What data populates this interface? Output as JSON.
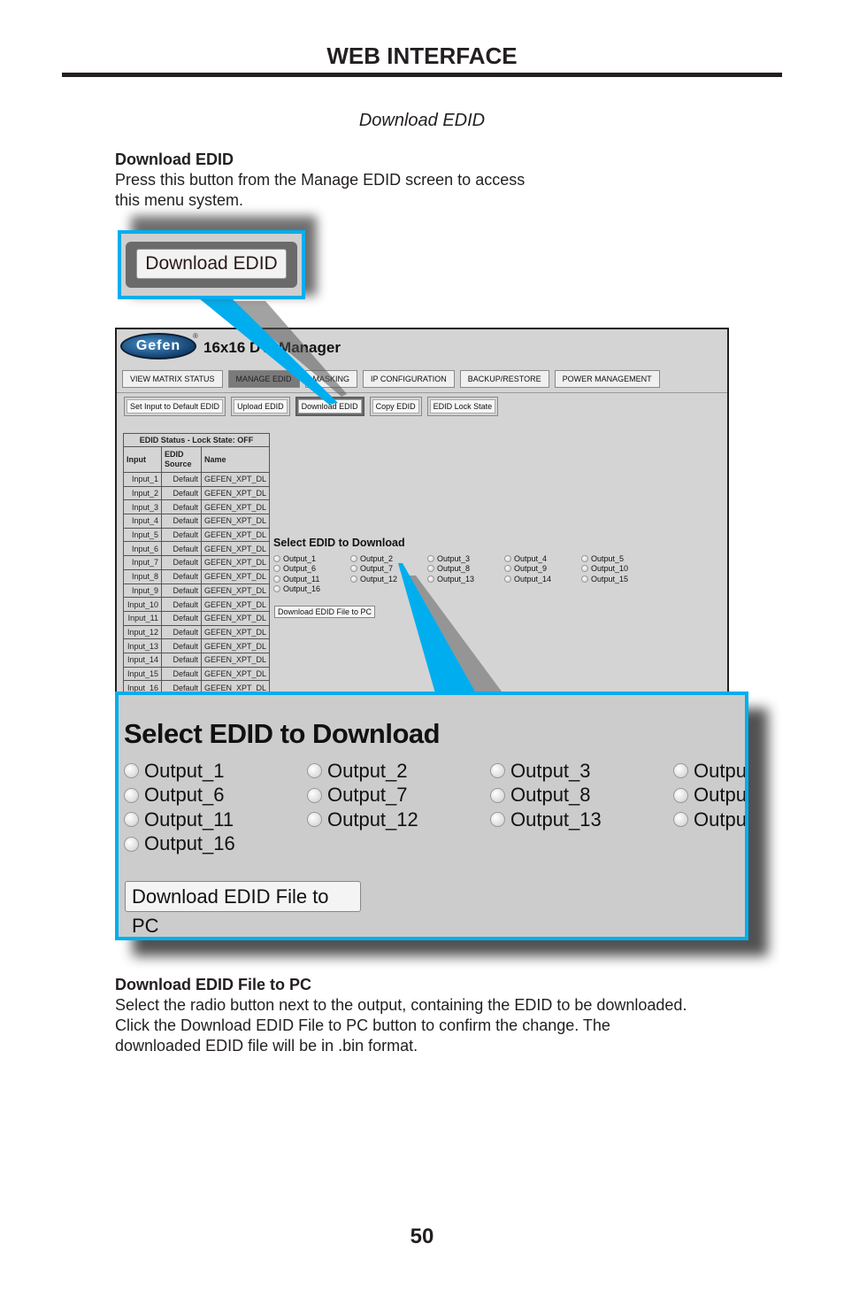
{
  "header": {
    "title": "WEB INTERFACE"
  },
  "section_caption": "Download EDID",
  "intro": {
    "title": "Download EDID",
    "body": "Press this button from the Manage EDID screen to access this menu system."
  },
  "callout_button": {
    "label": "Download EDID"
  },
  "app": {
    "logo_text": "Gefen",
    "logo_mark": "®",
    "title": "16x16 DVI Manager",
    "tabs": [
      {
        "label": "VIEW MATRIX STATUS",
        "active": false
      },
      {
        "label": "MANAGE EDID",
        "active": true
      },
      {
        "label": "MASKING",
        "active": false
      },
      {
        "label": "IP CONFIGURATION",
        "active": false
      },
      {
        "label": "BACKUP/RESTORE",
        "active": false
      },
      {
        "label": "POWER MANAGEMENT",
        "active": false
      }
    ],
    "sub_buttons": [
      {
        "label": "Set Input to Default EDID",
        "active": false
      },
      {
        "label": "Upload EDID",
        "active": false
      },
      {
        "label": "Download EDID",
        "active": true
      },
      {
        "label": "Copy EDID",
        "active": false
      },
      {
        "label": "EDID Lock State",
        "active": false
      }
    ],
    "edid_table": {
      "caption": "EDID Status - Lock State: OFF",
      "headers": [
        "Input",
        "EDID Source",
        "Name"
      ],
      "rows": [
        [
          "Input_1",
          "Default",
          "GEFEN_XPT_DL"
        ],
        [
          "Input_2",
          "Default",
          "GEFEN_XPT_DL"
        ],
        [
          "Input_3",
          "Default",
          "GEFEN_XPT_DL"
        ],
        [
          "Input_4",
          "Default",
          "GEFEN_XPT_DL"
        ],
        [
          "Input_5",
          "Default",
          "GEFEN_XPT_DL"
        ],
        [
          "Input_6",
          "Default",
          "GEFEN_XPT_DL"
        ],
        [
          "Input_7",
          "Default",
          "GEFEN_XPT_DL"
        ],
        [
          "Input_8",
          "Default",
          "GEFEN_XPT_DL"
        ],
        [
          "Input_9",
          "Default",
          "GEFEN_XPT_DL"
        ],
        [
          "Input_10",
          "Default",
          "GEFEN_XPT_DL"
        ],
        [
          "Input_11",
          "Default",
          "GEFEN_XPT_DL"
        ],
        [
          "Input_12",
          "Default",
          "GEFEN_XPT_DL"
        ],
        [
          "Input_13",
          "Default",
          "GEFEN_XPT_DL"
        ],
        [
          "Input_14",
          "Default",
          "GEFEN_XPT_DL"
        ],
        [
          "Input_15",
          "Default",
          "GEFEN_XPT_DL"
        ],
        [
          "Input_16",
          "Default",
          "GEFEN_XPT_DL"
        ]
      ]
    },
    "select_title": "Select EDID to Download",
    "outputs": [
      "Output_1",
      "Output_2",
      "Output_3",
      "Output_4",
      "Output_5",
      "Output_6",
      "Output_7",
      "Output_8",
      "Output_9",
      "Output_10",
      "Output_11",
      "Output_12",
      "Output_13",
      "Output_14",
      "Output_15",
      "Output_16"
    ],
    "download_button": "Download EDID File to PC"
  },
  "zoom_callout": {
    "title": "Select EDID to Download",
    "outputs": [
      "Output_1",
      "Output_2",
      "Output_3",
      "Outpu",
      "Output_6",
      "Output_7",
      "Output_8",
      "Outpu",
      "Output_11",
      "Output_12",
      "Output_13",
      "Outpu",
      "Output_16"
    ],
    "download_button": "Download EDID File to PC"
  },
  "outro": {
    "title": "Download EDID File to PC",
    "body": "Select the radio button next to the output, containing the EDID to be downloaded.  Click the Download EDID File to PC button to confirm the change.  The downloaded EDID file will be in .bin format."
  },
  "page_number": "50",
  "colors": {
    "callout_border": "#00aeef",
    "ui_background": "#d4d4d4",
    "text": "#231f20"
  }
}
